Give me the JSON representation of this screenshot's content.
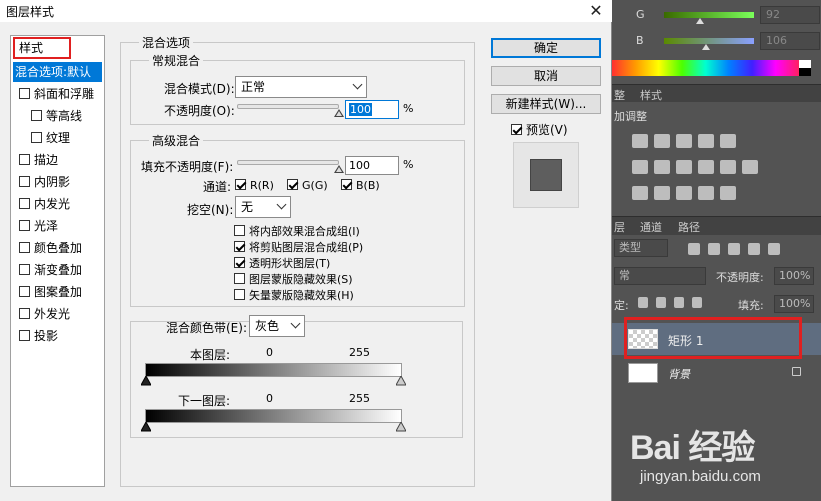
{
  "dialog": {
    "title": "图层样式",
    "close_glyph": "✕",
    "style_header": "样式",
    "style_items": [
      {
        "label": "混合选项:默认",
        "checkbox": false,
        "active": true
      },
      {
        "label": "斜面和浮雕",
        "checkbox": true
      },
      {
        "label": "等高线",
        "checkbox": true,
        "indent": true
      },
      {
        "label": "纹理",
        "checkbox": true,
        "indent": true
      },
      {
        "label": "描边",
        "checkbox": true
      },
      {
        "label": "内阴影",
        "checkbox": true
      },
      {
        "label": "内发光",
        "checkbox": true
      },
      {
        "label": "光泽",
        "checkbox": true
      },
      {
        "label": "颜色叠加",
        "checkbox": true
      },
      {
        "label": "渐变叠加",
        "checkbox": true
      },
      {
        "label": "图案叠加",
        "checkbox": true
      },
      {
        "label": "外发光",
        "checkbox": true
      },
      {
        "label": "投影",
        "checkbox": true
      }
    ],
    "blend_options_title": "混合选项",
    "general_blend": {
      "title": "常规混合",
      "mode_label": "混合模式(D):",
      "mode_value": "正常",
      "opacity_label": "不透明度(O):",
      "opacity_value": "100",
      "opacity_percent": 100,
      "unit": "%"
    },
    "advanced_blend": {
      "title": "高级混合",
      "fill_label": "填充不透明度(F):",
      "fill_value": "100",
      "fill_percent": 100,
      "unit": "%",
      "channels_label": "通道:",
      "channels": [
        {
          "label": "R(R)",
          "checked": true
        },
        {
          "label": "G(G)",
          "checked": true
        },
        {
          "label": "B(B)",
          "checked": true
        }
      ],
      "knockout_label": "挖空(N):",
      "knockout_value": "无",
      "options": [
        {
          "label": "将内部效果混合成组(I)",
          "checked": false
        },
        {
          "label": "将剪贴图层混合成组(P)",
          "checked": true
        },
        {
          "label": "透明形状图层(T)",
          "checked": true
        },
        {
          "label": "图层蒙版隐藏效果(S)",
          "checked": false
        },
        {
          "label": "矢量蒙版隐藏效果(H)",
          "checked": false
        }
      ]
    },
    "blend_if": {
      "label": "混合颜色带(E):",
      "value": "灰色",
      "this_layer_label": "本图层:",
      "this_layer_min": "0",
      "this_layer_max": "255",
      "underlying_label": "下一图层:",
      "underlying_min": "0",
      "underlying_max": "255"
    },
    "buttons": {
      "ok": "确定",
      "cancel": "取消",
      "new_style": "新建样式(W)...",
      "preview_label": "预览(V)",
      "preview_checked": true
    }
  },
  "photoshop_bg": {
    "color_sliders": [
      {
        "label": "G",
        "value": "92",
        "slider_percent": 36
      },
      {
        "label": "B",
        "value": "106",
        "slider_percent": 42
      }
    ],
    "tabs_top": [
      "整",
      "样式"
    ],
    "adjust_title": "加调整",
    "layers_tabs": [
      "层",
      "通道",
      "路径"
    ],
    "kind_label": "类型",
    "blend_mode": "常",
    "opacity_label": "不透明度:",
    "opacity_value": "100%",
    "lock_label": "定:",
    "fill_label": "填充:",
    "fill_value": "100%",
    "layers": [
      {
        "name": "矩形 1",
        "selected": true
      },
      {
        "name": "背景",
        "selected": false
      }
    ]
  },
  "watermark": {
    "main": "Bai  经验",
    "sub": "jingyan.baidu.com"
  },
  "colors": {
    "accent": "#0078d7",
    "highlight_red": "#e02020",
    "ps_dark": "#535353",
    "selected_layer": "#5f6d80"
  }
}
